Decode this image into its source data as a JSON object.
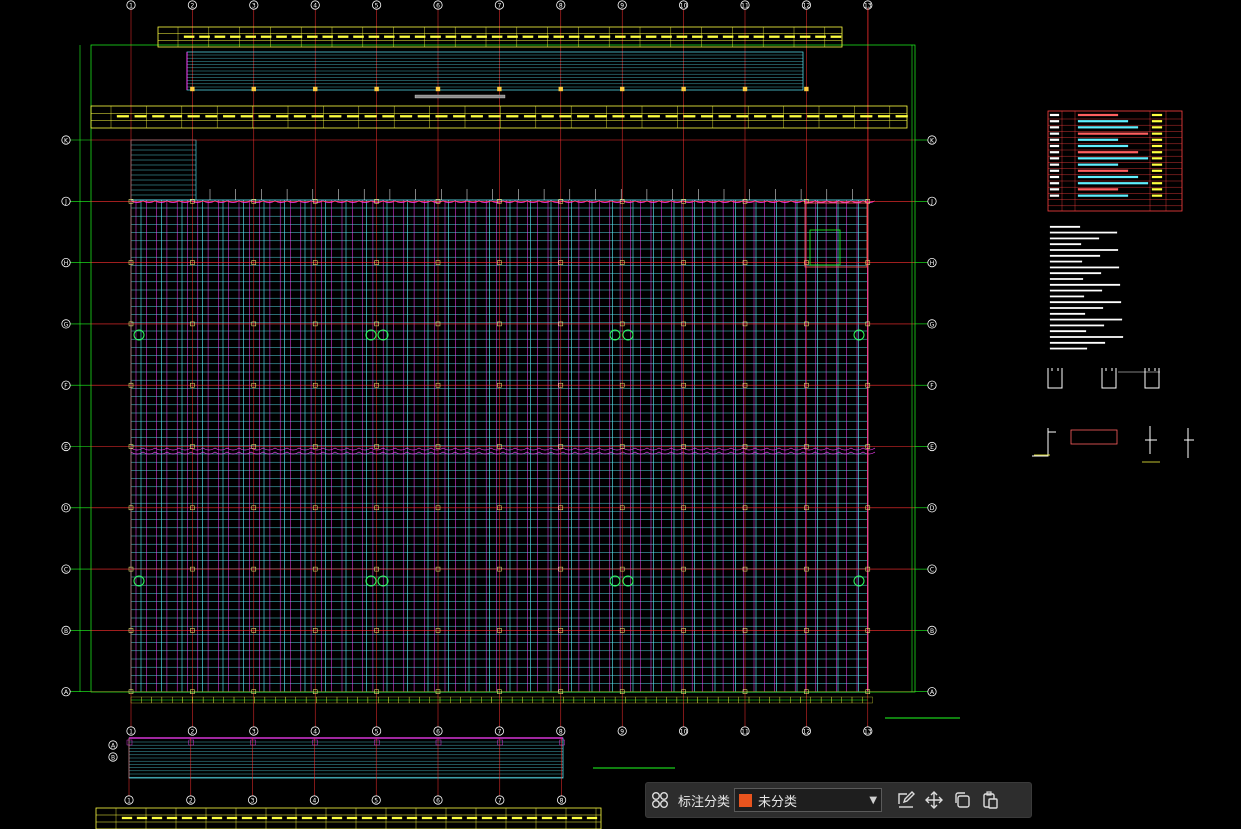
{
  "toolbar": {
    "category_label": "标注分类",
    "category_value": "未分类",
    "category_color": "#e8541e"
  },
  "drawing": {
    "grid_cols": [
      "1",
      "2",
      "3",
      "4",
      "5",
      "6",
      "7",
      "8",
      "9",
      "10",
      "11",
      "12",
      "13"
    ],
    "grid_rows": [
      "K",
      "J",
      "H",
      "G",
      "F",
      "E",
      "D",
      "C",
      "B",
      "A"
    ],
    "bottom_grid_cols": [
      "1",
      "2",
      "3",
      "4",
      "5",
      "6",
      "7",
      "8"
    ],
    "colors": {
      "grid_line": "#ff3030",
      "border": "#20ff20",
      "purlin_cyan": "#5ff0ff",
      "purlin_magenta": "#ff40ff",
      "table_yellow": "#ffff40",
      "note_white": "#ffffff"
    }
  }
}
